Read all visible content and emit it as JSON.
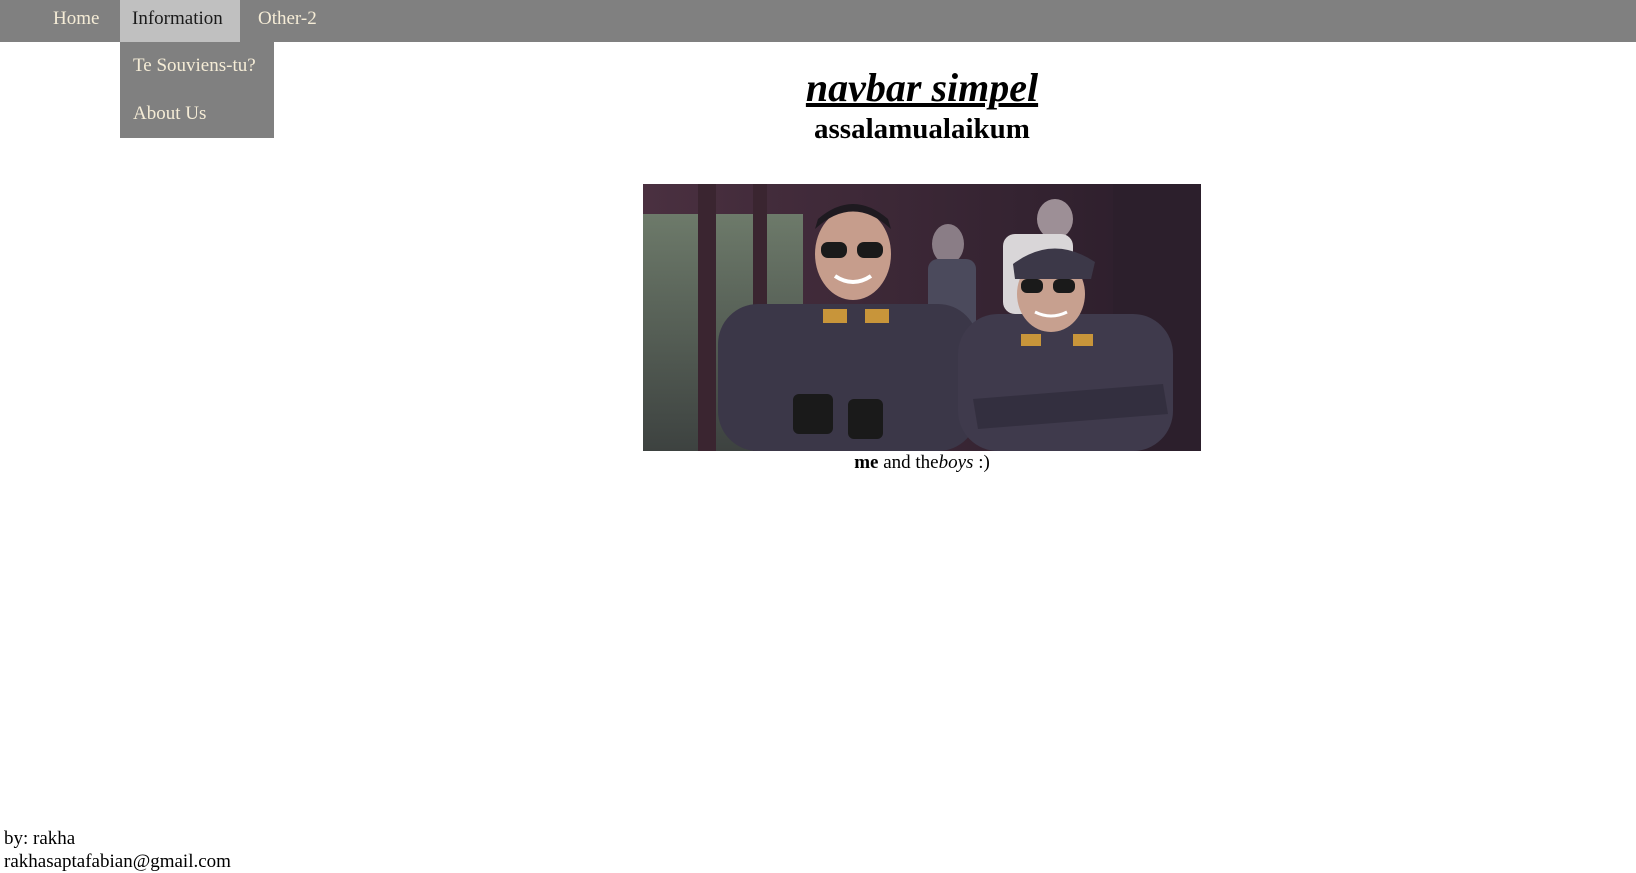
{
  "navbar": {
    "items": [
      {
        "label": "Home"
      },
      {
        "label": "Information"
      },
      {
        "label": "Other-2"
      }
    ],
    "active": "Information",
    "dropdown": [
      {
        "label": "Te Souviens-tu?"
      },
      {
        "label": "About Us"
      }
    ]
  },
  "main": {
    "title": "navbar simpel",
    "subtitle": "assalamualaikum",
    "caption": {
      "bold": "me",
      "middle": " and the",
      "italic": "boys",
      "end": " :)"
    }
  },
  "footer": {
    "author": "by: rakha",
    "email": "rakhasaptafabian@gmail.com"
  },
  "colors": {
    "navbar_bg": "#808080",
    "nav_text": "#f5ecd6",
    "active_bg": "#c0c0c0"
  }
}
